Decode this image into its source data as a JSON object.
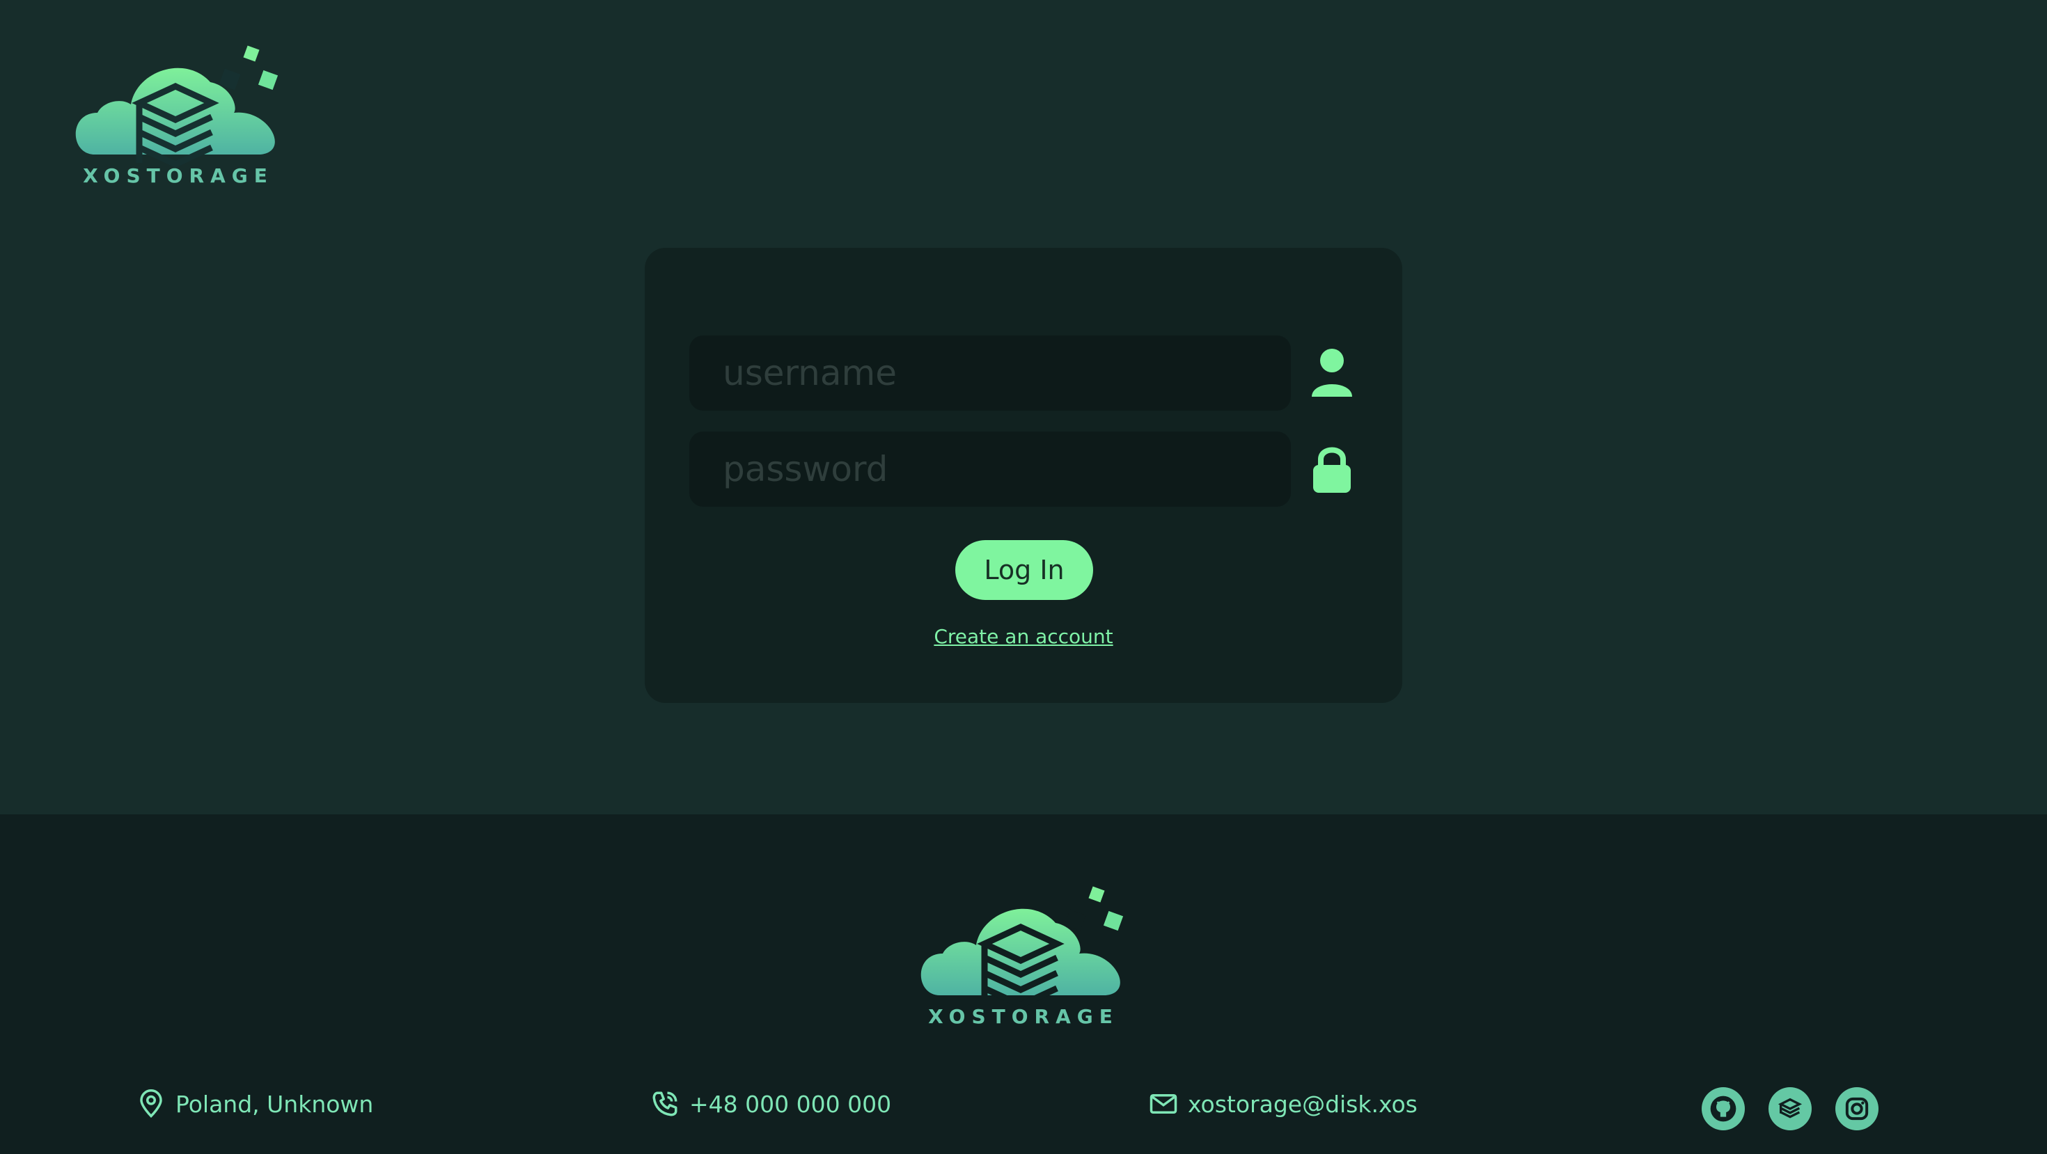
{
  "brand": {
    "name": "XOSTORAGE",
    "accent_color": "#7ff59f",
    "background_color": "#172d2b"
  },
  "login": {
    "username_placeholder": "username",
    "username_value": "",
    "password_placeholder": "password",
    "password_value": "",
    "submit_label": "Log In",
    "create_account_label": "Create an account",
    "icons": {
      "username": "user-icon",
      "password": "lock-icon"
    }
  },
  "footer": {
    "location": {
      "icon": "location-pin-icon",
      "text": "Poland, Unknown"
    },
    "phone": {
      "icon": "phone-icon",
      "text": "+48 000 000 000"
    },
    "email": {
      "icon": "mail-icon",
      "text": "xostorage@disk.xos"
    },
    "socials": [
      {
        "name": "github",
        "icon": "github-icon"
      },
      {
        "name": "stack",
        "icon": "stack-icon"
      },
      {
        "name": "instagram",
        "icon": "instagram-icon"
      }
    ]
  }
}
